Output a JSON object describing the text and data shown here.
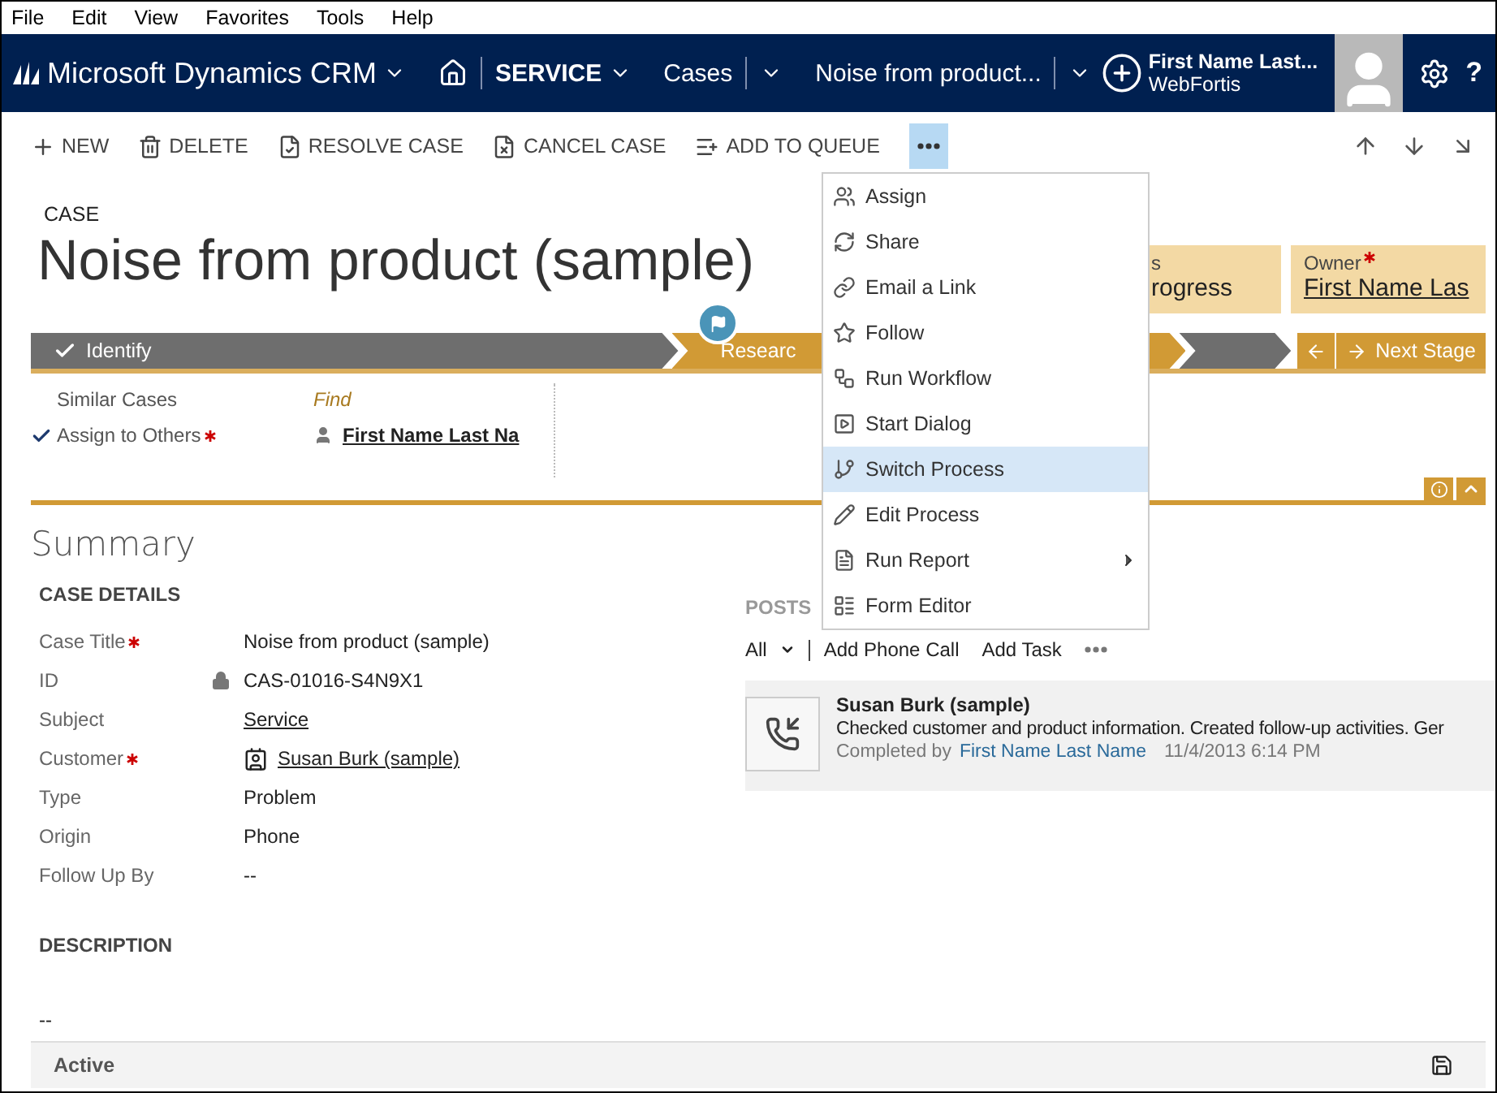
{
  "browser_menu": [
    "File",
    "Edit",
    "View",
    "Favorites",
    "Tools",
    "Help"
  ],
  "nav": {
    "app_title": "Microsoft Dynamics CRM",
    "area": "SERVICE",
    "entity": "Cases",
    "record": "Noise from product...",
    "user_name": "First Name Last...",
    "organization": "WebFortis",
    "help": "?"
  },
  "commands": [
    {
      "kind": "new",
      "label": "NEW"
    },
    {
      "kind": "delete",
      "label": "DELETE"
    },
    {
      "kind": "resolve",
      "label": "RESOLVE CASE"
    },
    {
      "kind": "cancel",
      "label": "CANCEL CASE"
    },
    {
      "kind": "queue",
      "label": "ADD TO QUEUE"
    },
    {
      "kind": "more",
      "expanded": true
    }
  ],
  "record": {
    "entity_label": "CASE",
    "title": "Noise from product (sample)"
  },
  "header_fields": [
    {
      "label": "s",
      "value": "rogress",
      "required": false,
      "link": false
    },
    {
      "label": "Owner",
      "value": "First Name Las",
      "required": true,
      "link": true
    }
  ],
  "process": {
    "stages": [
      {
        "label": "Identify",
        "completed": true,
        "active": false
      },
      {
        "label": "Researc",
        "completed": false,
        "active": true
      },
      {
        "completed": false,
        "active": false
      }
    ],
    "next_label": "Next Stage"
  },
  "stage_steps": [
    {
      "label": "Similar Cases",
      "kind": "action",
      "value": "Find",
      "required": false,
      "completed": false
    },
    {
      "label": "Assign to Others",
      "kind": "lookup",
      "value": "First Name Last Na",
      "required": true,
      "completed": true
    }
  ],
  "summary": {
    "title": "Summary",
    "section": "CASE DETAILS",
    "fields": [
      {
        "label": "Case Title",
        "kind": "text",
        "value": "Noise from product (sample)",
        "required": true,
        "locked": false
      },
      {
        "label": "ID",
        "kind": "text",
        "value": "CAS-01016-S4N9X1",
        "required": false,
        "locked": true
      },
      {
        "label": "Subject",
        "kind": "link",
        "value": "Service",
        "required": false,
        "locked": false
      },
      {
        "label": "Customer",
        "kind": "contact",
        "value": "Susan Burk (sample)",
        "required": true,
        "locked": false
      },
      {
        "label": "Type",
        "kind": "text",
        "value": "Problem",
        "required": false,
        "locked": false
      },
      {
        "label": "Origin",
        "kind": "text",
        "value": "Phone",
        "required": false,
        "locked": false
      },
      {
        "label": "Follow Up By",
        "kind": "text",
        "value": "--",
        "required": false,
        "locked": false
      }
    ],
    "description_heading": "DESCRIPTION",
    "description": "--"
  },
  "posts": {
    "heading": "POSTS",
    "filter": "All",
    "actions": [
      "Add Phone Call",
      "Add Task"
    ],
    "activities": [
      {
        "kind": "phone",
        "title": "Susan Burk (sample)",
        "text": "Checked customer and product information. Created follow-up activities. Ger",
        "completed_by_label": "Completed by",
        "completed_by": "First Name Last Name",
        "timestamp": "11/4/2013 6:14 PM"
      }
    ]
  },
  "footer": {
    "status": "Active"
  },
  "more_menu": [
    {
      "kind": "assign",
      "label": "Assign",
      "selected": false,
      "submenu": false
    },
    {
      "kind": "share",
      "label": "Share",
      "selected": false,
      "submenu": false
    },
    {
      "kind": "link",
      "label": "Email a Link",
      "selected": false,
      "submenu": false
    },
    {
      "kind": "follow",
      "label": "Follow",
      "selected": false,
      "submenu": false
    },
    {
      "kind": "workflow",
      "label": "Run Workflow",
      "selected": false,
      "submenu": false
    },
    {
      "kind": "dialog",
      "label": "Start Dialog",
      "selected": false,
      "submenu": false
    },
    {
      "kind": "process",
      "label": "Switch Process",
      "selected": true,
      "submenu": false
    },
    {
      "kind": "edit",
      "label": "Edit Process",
      "selected": false,
      "submenu": false
    },
    {
      "kind": "report",
      "label": "Run Report",
      "selected": false,
      "submenu": true
    },
    {
      "kind": "form",
      "label": "Form Editor",
      "selected": false,
      "submenu": false
    }
  ]
}
